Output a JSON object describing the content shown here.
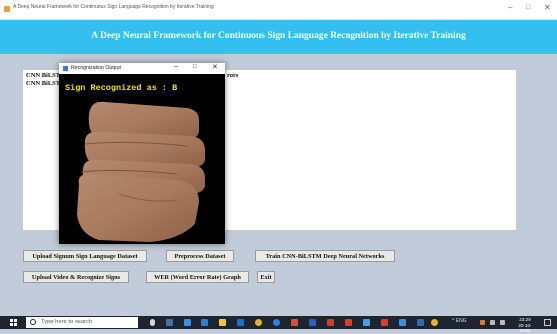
{
  "window": {
    "title": "A Deep Neural Framework for Continuous Sign Language Recognition by Iterative Training",
    "controls": [
      "–",
      "□",
      "✕"
    ]
  },
  "header": {
    "heading": "A Deep Neural Framework for Continuous Sign Language Recognition by Iterative Training",
    "background_color": "#33bfef"
  },
  "output": {
    "line1": "CNN BiLST",
    "line2": "CNN BiLST",
    "line3": "rors"
  },
  "popup": {
    "title": "Recognization Output",
    "controls": [
      "–",
      "□",
      "✕"
    ],
    "recognized_text": "Sign Recognized as : B"
  },
  "buttons": {
    "upload_dataset": "Upload Signum Sign Language Dataset",
    "preprocess": "Preprocess Dataset",
    "train": "Train CNN-BiLSTM Deep Neural Networks",
    "upload_video": "Upload Video & Recognize Signs",
    "wer_graph": "WER (Word Error Rate) Graph",
    "exit": "Exit"
  },
  "taskbar": {
    "search_placeholder": "Type here to search",
    "time": "23:29",
    "date": "20-10-2020",
    "tray_text": "^ ENG",
    "icons": [
      "task-view-icon",
      "edge-icon",
      "store-icon",
      "file-explorer-icon",
      "mail-icon",
      "chrome-icon",
      "ie-icon",
      "app-icon",
      "word-icon",
      "excel-icon",
      "powerpoint-icon",
      "paint-icon",
      "acrobat-icon",
      "python-icon",
      "java-icon"
    ]
  }
}
